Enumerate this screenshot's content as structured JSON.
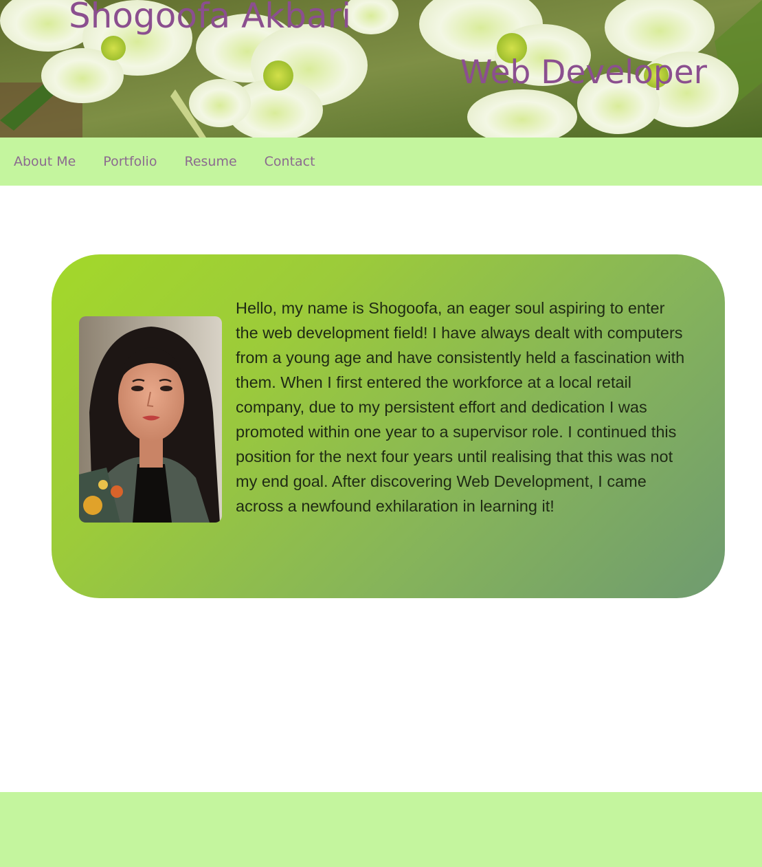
{
  "header": {
    "name": "Shogoofa Akbari",
    "role": "Web Developer",
    "banner_image": "white-hellebore-flowers-photo"
  },
  "nav": {
    "items": [
      {
        "label": "About Me"
      },
      {
        "label": "Portfolio"
      },
      {
        "label": "Resume"
      },
      {
        "label": "Contact"
      }
    ]
  },
  "about": {
    "photo": "profile-portrait-photo",
    "text": "Hello, my name is Shogoofa, an eager soul aspiring to enter the web development field! I have always dealt with computers from a young age and have consistently held a fascination with them. When I first entered the workforce at a local retail company, due to my persistent effort and dedication I was promoted within one year to a supervisor role. I continued this position for the next four years until realising that this was not my end goal. After discovering Web Development, I came across a newfound exhilaration in learning it!"
  },
  "colors": {
    "accent_purple": "#8b4f8f",
    "nav_green": "#c4f59e",
    "card_gradient_start": "#a3d82a",
    "card_gradient_end": "#6f9b70"
  }
}
